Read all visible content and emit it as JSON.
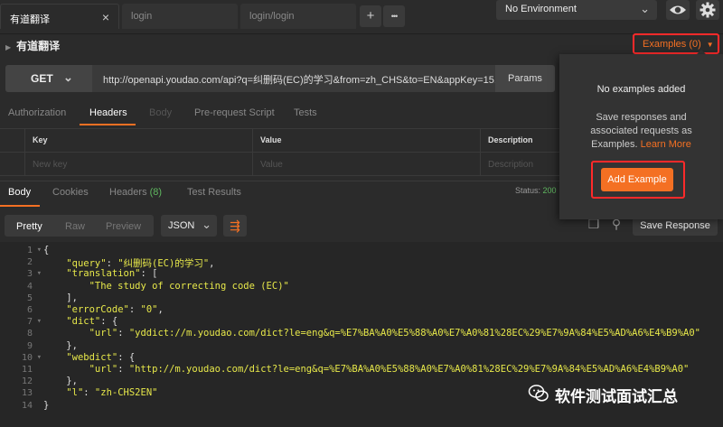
{
  "tabs": [
    {
      "label": "有道翻译",
      "active": true
    },
    {
      "label": "login",
      "active": false
    },
    {
      "label": "login/login",
      "active": false
    }
  ],
  "tab_actions": {
    "add": "+",
    "more": "•••"
  },
  "environment": {
    "selected": "No Environment"
  },
  "request": {
    "name": "有道翻译",
    "method": "GET",
    "url": "http://openapi.youdao.com/api?q=纠删码(EC)的学习&from=zh_CHS&to=EN&appKey=15...",
    "params_label": "Params"
  },
  "examples_button": "Examples (0)",
  "request_tabs": [
    "Authorization",
    "Headers",
    "Body",
    "Pre-request Script",
    "Tests"
  ],
  "headers_table": {
    "columns": [
      "Key",
      "Value",
      "Description"
    ],
    "placeholders": [
      "New key",
      "Value",
      "Description"
    ]
  },
  "response_tabs": {
    "body": "Body",
    "cookies": "Cookies",
    "headers": "Headers",
    "headers_count": "(8)",
    "tests": "Test Results"
  },
  "status": {
    "label": "Status:",
    "value": "200"
  },
  "view_modes": [
    "Pretty",
    "Raw",
    "Preview"
  ],
  "format": "JSON",
  "save_response": "Save Response",
  "popover": {
    "title": "No examples added",
    "desc": "Save responses and associated requests as Examples.",
    "learn_more": "Learn More",
    "add_button": "Add Example"
  },
  "code_lines": [
    {
      "n": "1",
      "fold": "▾",
      "text": "{"
    },
    {
      "n": "2",
      "fold": "",
      "key": "\"query\"",
      "rest": ": \"纠删码(EC)的学习\","
    },
    {
      "n": "3",
      "fold": "▾",
      "key": "\"translation\"",
      "rest": ": ["
    },
    {
      "n": "4",
      "fold": "",
      "indent": "    ",
      "str": "\"The study of correcting code (EC)\""
    },
    {
      "n": "5",
      "fold": "",
      "text": "    ],"
    },
    {
      "n": "6",
      "fold": "",
      "key": "\"errorCode\"",
      "rest": ": \"0\","
    },
    {
      "n": "7",
      "fold": "▾",
      "key": "\"dict\"",
      "rest": ": {"
    },
    {
      "n": "8",
      "fold": "",
      "indent": "    ",
      "key": "\"url\"",
      "rest": ": \"yddict://m.youdao.com/dict?le=eng&q=%E7%BA%A0%E5%88%A0%E7%A0%81%28EC%29%E7%9A%84%E5%AD%A6%E4%B9%A0\""
    },
    {
      "n": "9",
      "fold": "",
      "text": "    },"
    },
    {
      "n": "10",
      "fold": "▾",
      "key": "\"webdict\"",
      "rest": ": {"
    },
    {
      "n": "11",
      "fold": "",
      "indent": "    ",
      "key": "\"url\"",
      "rest": ": \"http://m.youdao.com/dict?le=eng&q=%E7%BA%A0%E5%88%A0%E7%A0%81%28EC%29%E7%9A%84%E5%AD%A6%E4%B9%A0\""
    },
    {
      "n": "12",
      "fold": "",
      "text": "    },"
    },
    {
      "n": "13",
      "fold": "",
      "key": "\"l\"",
      "rest": ": \"zh-CHS2EN\""
    },
    {
      "n": "14",
      "fold": "",
      "text": "}"
    }
  ],
  "watermark": "软件测试面试汇总",
  "colors": {
    "accent": "#f47023",
    "highlight_box": "#ff2a2a",
    "json_text": "#e7e84a"
  }
}
